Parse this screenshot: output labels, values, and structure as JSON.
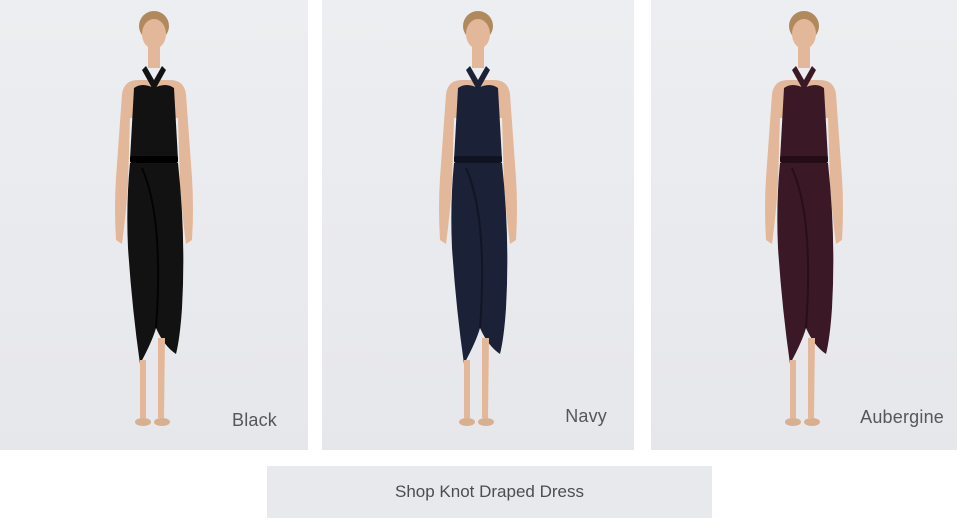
{
  "products": [
    {
      "color_name": "Black",
      "dress_color": "#121212",
      "shadow_color": "#000000"
    },
    {
      "color_name": "Navy",
      "dress_color": "#1b2136",
      "shadow_color": "#0f1322"
    },
    {
      "color_name": "Aubergine",
      "dress_color": "#3a1826",
      "shadow_color": "#240d17"
    }
  ],
  "skin_color": "#e3b89a",
  "hair_color": "#b08a5c",
  "shop_button": {
    "label": "Shop Knot Draped Dress"
  }
}
